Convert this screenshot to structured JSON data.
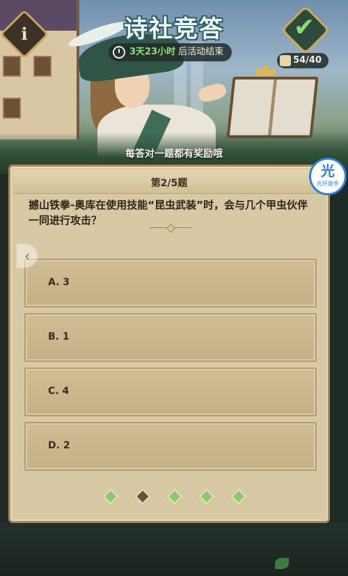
{
  "header": {
    "title": "诗社竞答",
    "info_label": "i",
    "timer_highlight": "3天23小时",
    "timer_suffix": "后活动结束",
    "progress": "54/40",
    "banner": "每答对一题都有奖励哦"
  },
  "question": {
    "number_label": "第2/5题",
    "text": "撼山铁拳-奥库在使用技能“昆虫武装”时，会与几个甲虫伙伴一同进行攻击？"
  },
  "options": [
    {
      "label": "A. 3"
    },
    {
      "label": "B. 1"
    },
    {
      "label": "C. 4"
    },
    {
      "label": "D. 2"
    }
  ],
  "pagination": {
    "total": 5,
    "current": 2
  },
  "assistant": {
    "big": "光",
    "small": "光环助手"
  },
  "side_arrow": "‹",
  "colors": {
    "accent_green": "#8ecb6b",
    "panel_bg": "#d8c8a4",
    "assistant_blue": "#2b7de9"
  }
}
